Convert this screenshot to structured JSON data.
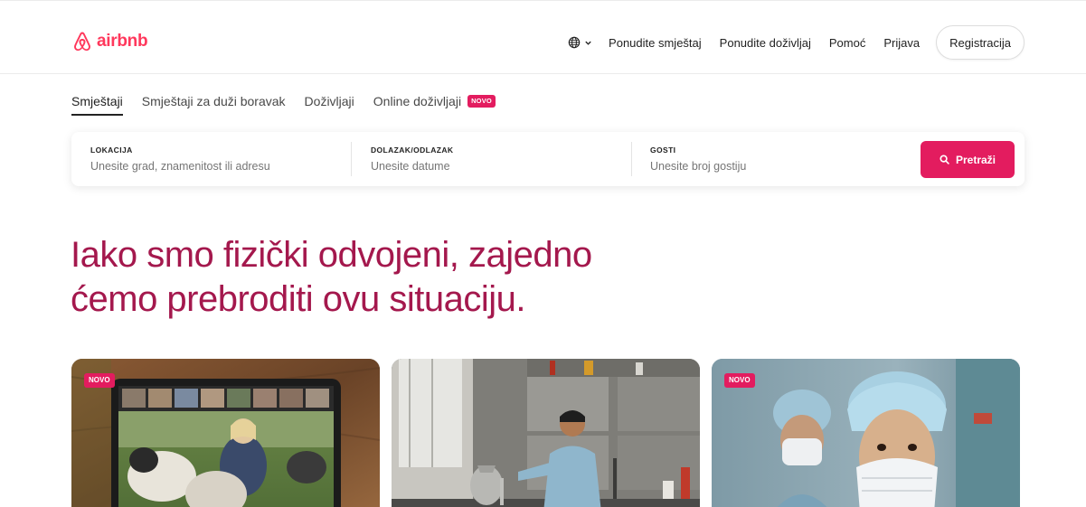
{
  "brand": {
    "name": "airbnb",
    "color": "#ff385c"
  },
  "header": {
    "language_icon": "globe-icon",
    "links": [
      "Ponudite smještaj",
      "Ponudite doživljaj",
      "Pomoć",
      "Prijava"
    ],
    "register_label": "Registracija"
  },
  "tabs": {
    "items": [
      "Smještaji",
      "Smještaji za duži boravak",
      "Doživljaji",
      "Online doživljaji"
    ],
    "active_index": 0,
    "new_badge": "NOVO"
  },
  "search": {
    "location": {
      "label": "LOKACIJA",
      "placeholder": "Unesite grad, znamenitost ili adresu"
    },
    "dates": {
      "label": "DOLAZAK/ODLAZAK",
      "placeholder": "Unesite datume"
    },
    "guests": {
      "label": "GOSTI",
      "placeholder": "Unesite broj gostiju"
    },
    "button_label": "Pretraži",
    "button_color": "#e31c5f"
  },
  "hero": {
    "line1": "Iako smo fizički odvojeni, zajedno",
    "line2": "ćemo prebroditi ovu situaciju.",
    "color": "#a4184d"
  },
  "cards": [
    {
      "badge": "NOVO",
      "image": "online-experience-sheep-video-call"
    },
    {
      "badge": "",
      "image": "man-cooking-in-kitchen"
    },
    {
      "badge": "NOVO",
      "image": "healthcare-workers-with-masks"
    }
  ]
}
